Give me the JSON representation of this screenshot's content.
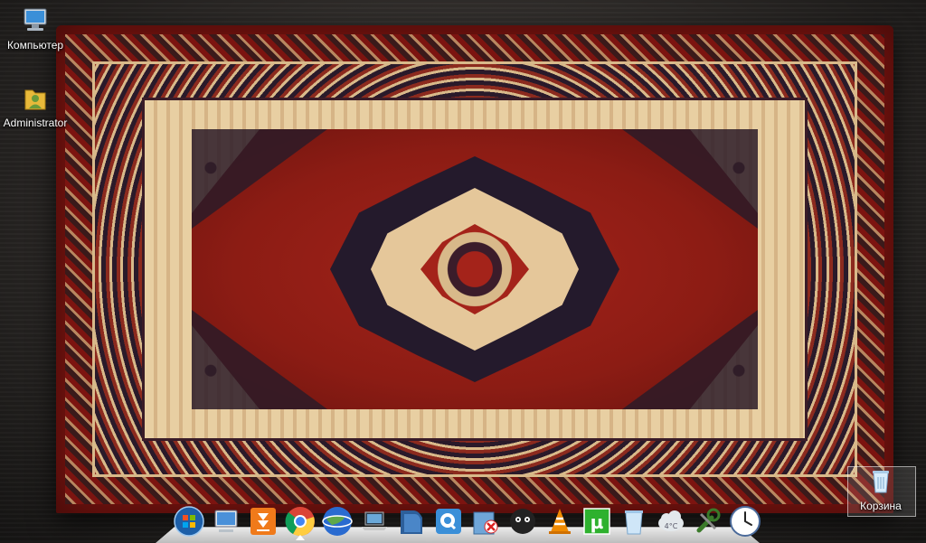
{
  "desktop": {
    "icons": [
      {
        "label": "Компьютер",
        "icon": "computer-icon"
      },
      {
        "label": "Administrator",
        "icon": "user-folder-icon"
      },
      {
        "label": "Корзина",
        "icon": "recycle-bin-icon"
      }
    ]
  },
  "dock": {
    "items": [
      {
        "name": "start-orb",
        "icon": "windows-logo-icon",
        "color": "#3a8fd8"
      },
      {
        "name": "my-computer",
        "icon": "computer-icon",
        "color": "#4a90d9"
      },
      {
        "name": "download-manager",
        "icon": "download-arrow-icon",
        "color": "#f07a1a"
      },
      {
        "name": "chrome",
        "icon": "chrome-icon",
        "color": "#db4437"
      },
      {
        "name": "google-earth",
        "icon": "globe-icon",
        "color": "#2a6bd0"
      },
      {
        "name": "laptop",
        "icon": "laptop-icon",
        "color": "#a0a0a0"
      },
      {
        "name": "qip-folder",
        "icon": "folder-icon",
        "color": "#2d5f9a"
      },
      {
        "name": "qip-messenger",
        "icon": "chat-icon",
        "color": "#3a8fd8"
      },
      {
        "name": "tools-box",
        "icon": "box-icon",
        "color": "#6fa6d8"
      },
      {
        "name": "media-player",
        "icon": "sheep-icon",
        "color": "#222222"
      },
      {
        "name": "vlc",
        "icon": "vlc-cone-icon",
        "color": "#f08a00"
      },
      {
        "name": "utorrent",
        "icon": "utorrent-icon",
        "color": "#2eb12e"
      },
      {
        "name": "trash",
        "icon": "trash-icon",
        "color": "#9fc6e8"
      },
      {
        "name": "weather",
        "icon": "weather-cloud-icon",
        "color": "#cfd6dc"
      },
      {
        "name": "tools",
        "icon": "wrench-icon",
        "color": "#3a7a2a"
      },
      {
        "name": "clock",
        "icon": "clock-icon",
        "color": "#ffffff"
      }
    ],
    "weather_temp": "4°C"
  }
}
